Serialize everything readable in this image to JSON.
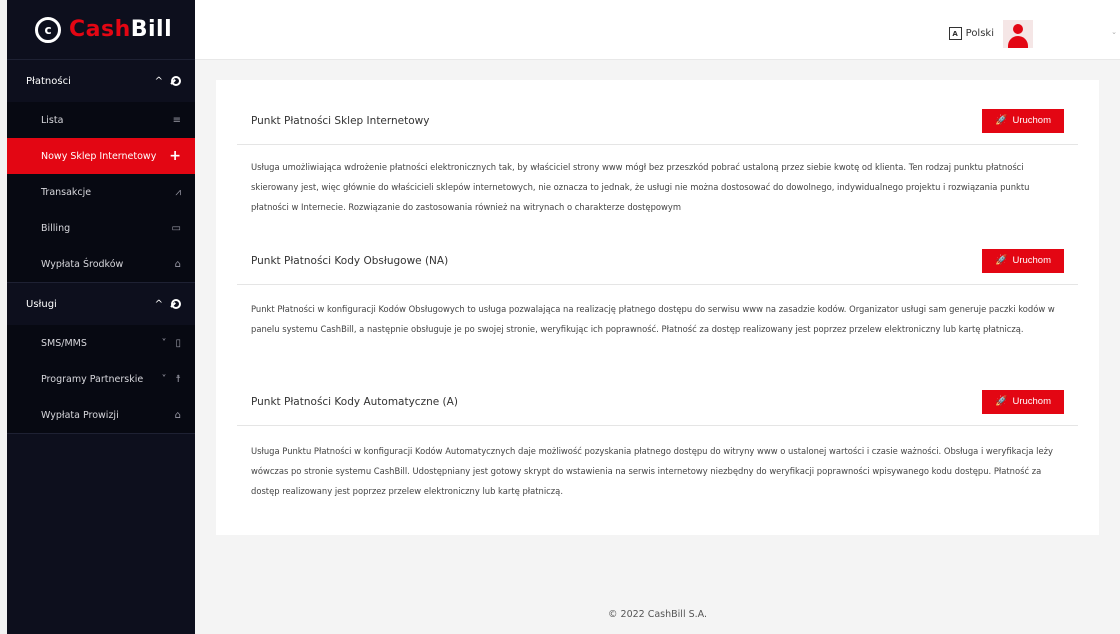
{
  "logo": {
    "mark": "c",
    "cash": "Cash",
    "bill": "Bill"
  },
  "sidebar": {
    "sections": [
      {
        "label": "Płatności",
        "toggle": "^"
      },
      {
        "label": "Usługi",
        "toggle": "^"
      }
    ],
    "payments_items": [
      {
        "label": "Lista",
        "icon": "≡"
      },
      {
        "label": "Nowy Sklep Internetowy",
        "icon": "+"
      },
      {
        "label": "Transakcje",
        "icon": "⩘"
      },
      {
        "label": "Billing",
        "icon": "▭"
      },
      {
        "label": "Wypłata Środków",
        "icon": "⌂"
      }
    ],
    "services_items": [
      {
        "label": "SMS/MMS",
        "chevron": "˅",
        "icon": "▯"
      },
      {
        "label": "Programy Partnerskie",
        "chevron": "˅",
        "icon": "☨"
      },
      {
        "label": "Wypłata Prowizji",
        "icon": "⌂"
      }
    ]
  },
  "topbar": {
    "language": "Polski",
    "lang_icon": "A",
    "caret": "⌄"
  },
  "panels": [
    {
      "title": "Punkt Płatności Sklep Internetowy",
      "button": "Uruchom",
      "description": "Usługa umożliwiająca wdrożenie płatności elektronicznych tak, by właściciel strony www mógł bez przeszkód pobrać ustaloną przez siebie kwotę od klienta. Ten rodzaj punktu płatności skierowany jest, więc głównie do właścicieli sklepów internetowych, nie oznacza to jednak, że usługi nie można dostosować do dowolnego, indywidualnego projektu i rozwiązania punktu płatności w Internecie. Rozwiązanie do zastosowania również na witrynach o charakterze dostępowym"
    },
    {
      "title": "Punkt Płatności Kody Obsługowe (NA)",
      "button": "Uruchom",
      "description": "Punkt Płatności w konfiguracji Kodów Obsługowych to usługa pozwalająca na realizację płatnego dostępu do serwisu www na zasadzie kodów. Organizator usługi sam generuje paczki kodów w panelu systemu CashBill, a następnie obsługuje je po swojej stronie, weryfikując ich poprawność. Płatność za dostęp realizowany jest poprzez przelew elektroniczny lub kartę płatniczą."
    },
    {
      "title": "Punkt Płatności Kody Automatyczne (A)",
      "button": "Uruchom",
      "description": "Usługa Punktu Płatności w konfiguracji Kodów Automatycznych daje możliwość pozyskania płatnego dostępu do witryny www o ustalonej wartości i czasie ważności. Obsługa i weryfikacja leży wówczas po stronie systemu CashBill. Udostępniany jest gotowy skrypt do wstawienia na serwis internetowy niezbędny do weryfikacji poprawności wpisywanego kodu dostępu. Płatność za dostęp realizowany jest poprzez przelew elektroniczny lub kartę płatniczą."
    }
  ],
  "footer": "© 2022 CashBill S.A.",
  "colors": {
    "accent": "#e30613",
    "sidebar_bg": "#0d0f1d"
  }
}
